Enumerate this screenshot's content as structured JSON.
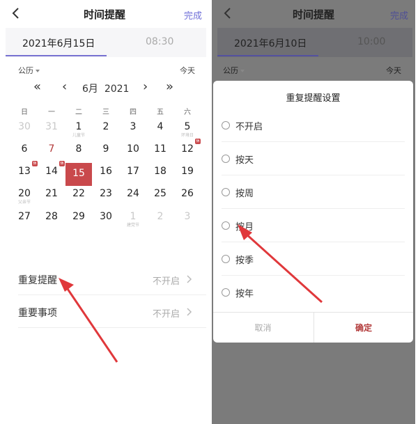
{
  "left": {
    "header": {
      "title": "时间提醒",
      "done": "完成"
    },
    "tabs": {
      "date": "2021年6月15日",
      "time": "08:30"
    },
    "calendar_type": "公历",
    "today": "今天",
    "nav": {
      "month": "6月",
      "year": "2021"
    },
    "weekdays": [
      "日",
      "一",
      "二",
      "三",
      "四",
      "五",
      "六"
    ],
    "days": [
      {
        "n": "30",
        "sub": "",
        "muted": true
      },
      {
        "n": "31",
        "sub": "",
        "muted": true
      },
      {
        "n": "1",
        "sub": "儿童节",
        "muted": false
      },
      {
        "n": "2",
        "sub": "",
        "muted": false
      },
      {
        "n": "3",
        "sub": "",
        "muted": false
      },
      {
        "n": "4",
        "sub": "",
        "muted": false
      },
      {
        "n": "5",
        "sub": "环境日",
        "muted": false
      },
      {
        "n": "6",
        "sub": "",
        "muted": false
      },
      {
        "n": "7",
        "sub": "",
        "muted": false,
        "red": true
      },
      {
        "n": "8",
        "sub": "",
        "muted": false
      },
      {
        "n": "9",
        "sub": "",
        "muted": false
      },
      {
        "n": "10",
        "sub": "",
        "muted": false
      },
      {
        "n": "11",
        "sub": "",
        "muted": false
      },
      {
        "n": "12",
        "sub": "",
        "muted": false,
        "badge": "休"
      },
      {
        "n": "13",
        "sub": "",
        "muted": false,
        "badge": "休"
      },
      {
        "n": "14",
        "sub": "",
        "muted": false,
        "badge": "休"
      },
      {
        "n": "15",
        "sub": "",
        "muted": false,
        "selected": true
      },
      {
        "n": "16",
        "sub": "",
        "muted": false
      },
      {
        "n": "17",
        "sub": "",
        "muted": false
      },
      {
        "n": "18",
        "sub": "",
        "muted": false
      },
      {
        "n": "19",
        "sub": "",
        "muted": false
      },
      {
        "n": "20",
        "sub": "父亲节",
        "muted": false
      },
      {
        "n": "21",
        "sub": "",
        "muted": false
      },
      {
        "n": "22",
        "sub": "",
        "muted": false
      },
      {
        "n": "23",
        "sub": "",
        "muted": false
      },
      {
        "n": "24",
        "sub": "",
        "muted": false
      },
      {
        "n": "25",
        "sub": "",
        "muted": false
      },
      {
        "n": "26",
        "sub": "",
        "muted": false
      },
      {
        "n": "27",
        "sub": "",
        "muted": false
      },
      {
        "n": "28",
        "sub": "",
        "muted": false
      },
      {
        "n": "29",
        "sub": "",
        "muted": false
      },
      {
        "n": "30",
        "sub": "",
        "muted": false
      },
      {
        "n": "1",
        "sub": "建党节",
        "muted": true
      },
      {
        "n": "2",
        "sub": "",
        "muted": true
      },
      {
        "n": "3",
        "sub": "",
        "muted": true
      }
    ],
    "repeat": {
      "label": "重复提醒",
      "value": "不开启"
    },
    "important": {
      "label": "重要事项",
      "value": "不开启"
    }
  },
  "right": {
    "header": {
      "title": "时间提醒",
      "done": "完成"
    },
    "tabs": {
      "date": "2021年6月10日",
      "time": "10:00"
    },
    "calendar_type": "公历",
    "today": "今天",
    "modal": {
      "title": "重复提醒设置",
      "options": [
        "不开启",
        "按天",
        "按周",
        "按月",
        "按季",
        "按年"
      ],
      "cancel": "取消",
      "confirm": "确定"
    }
  },
  "colors": {
    "accent": "#7771d1",
    "selected": "#c9494c",
    "arrow": "#e0383b"
  }
}
